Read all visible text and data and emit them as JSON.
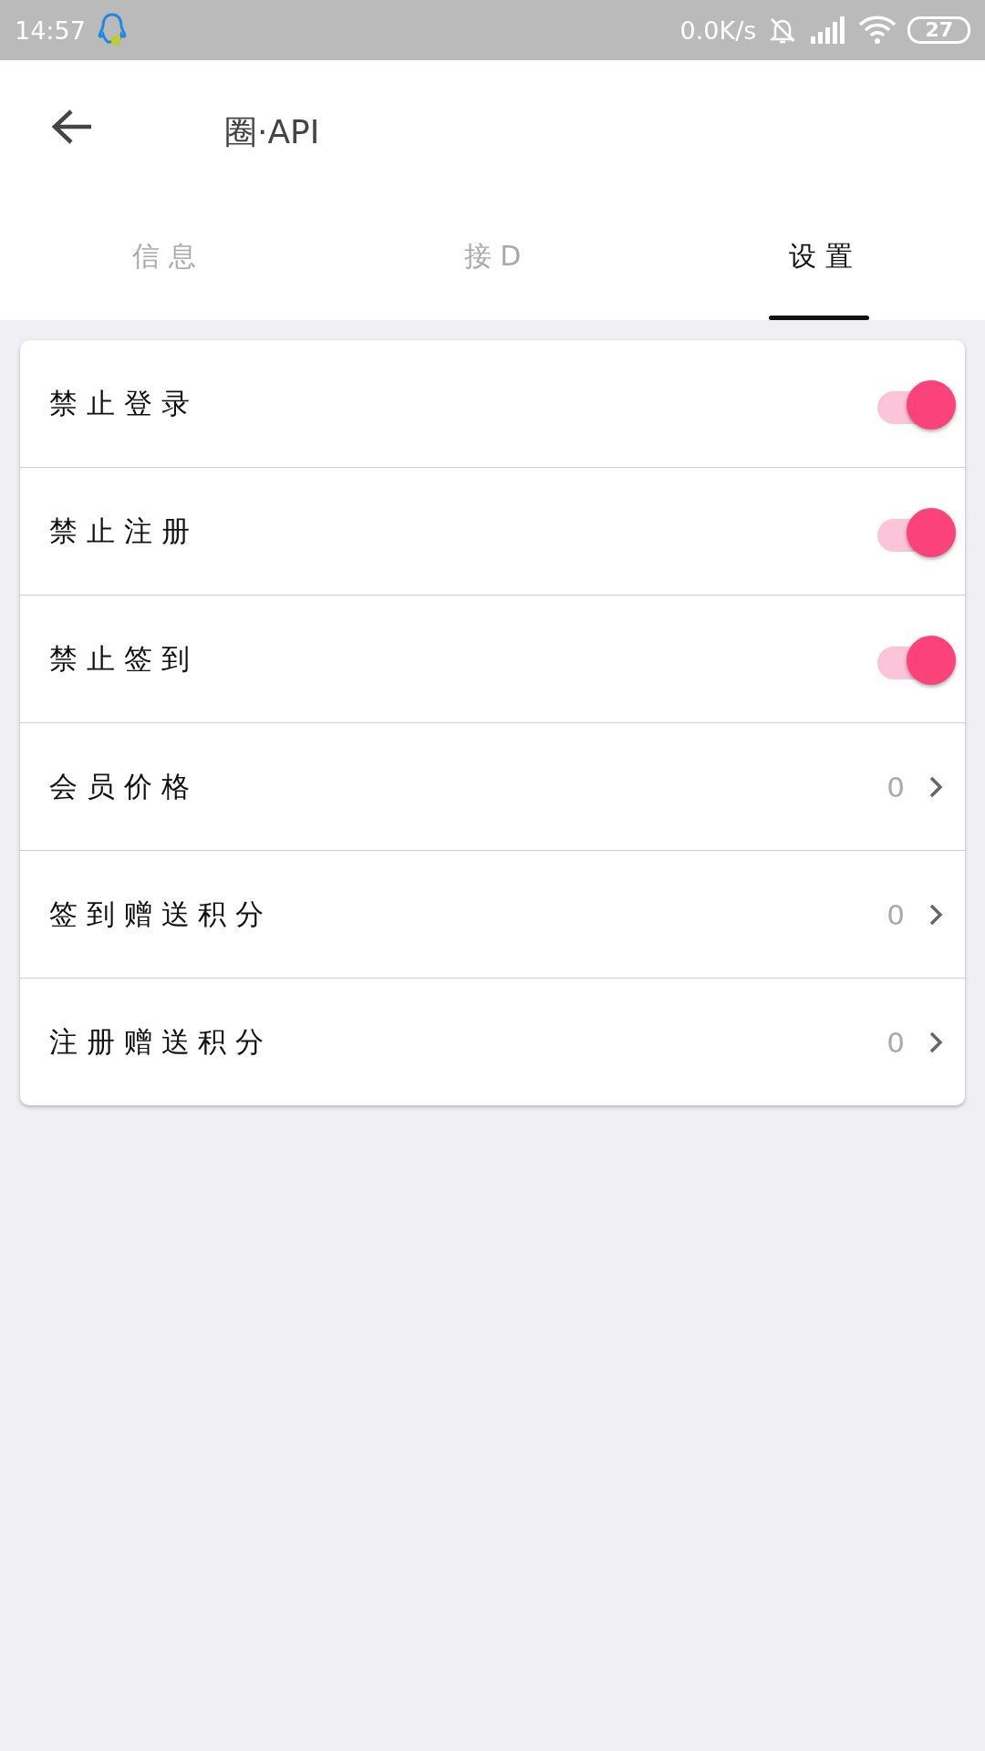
{
  "status_bar": {
    "time": "14:57",
    "speed": "0.0K/s",
    "battery": "27"
  },
  "header": {
    "title": "圈·API"
  },
  "tabs": [
    {
      "label": "信 息",
      "selected": false
    },
    {
      "label": "接 D",
      "selected": false
    },
    {
      "label": "设 置",
      "selected": true
    }
  ],
  "settings": [
    {
      "kind": "switch",
      "label": "禁 止 登 录",
      "on": true
    },
    {
      "kind": "switch",
      "label": "禁 止 注 册",
      "on": true
    },
    {
      "kind": "switch",
      "label": "禁 止 签 到",
      "on": true
    },
    {
      "kind": "value",
      "label": "会 员 价 格",
      "value": "0"
    },
    {
      "kind": "value",
      "label": "签 到 赠 送 积 分",
      "value": "0"
    },
    {
      "kind": "value",
      "label": "注 册 赠 送 积 分",
      "value": "0"
    }
  ]
}
